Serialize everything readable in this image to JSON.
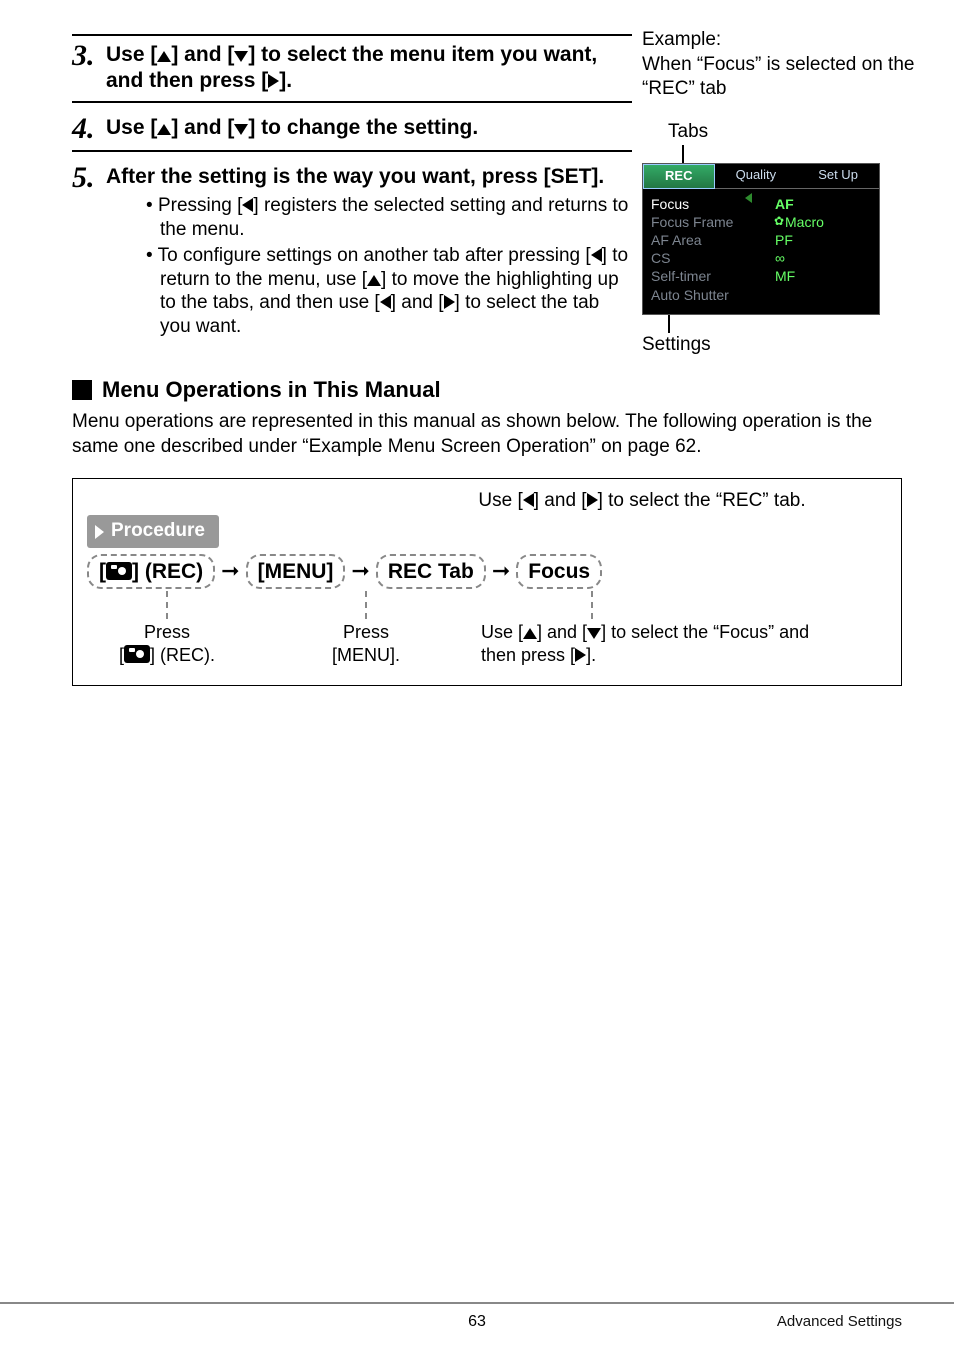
{
  "steps": {
    "s3": {
      "num": "3.",
      "body": "Use [▲] and [▼] to select the menu item you want, and then press [▶]."
    },
    "s4": {
      "num": "4.",
      "body": "Use [▲] and [▼] to change the setting."
    },
    "s5": {
      "num": "5.",
      "body": "After the setting is the way you want, press [SET]."
    },
    "s5_b1": "Pressing [◀] registers the selected setting and returns to the menu.",
    "s5_b2": "To configure settings on another tab after pressing [◀] to return to the menu, use [▲] to move the highlighting up to the tabs, and then use [◀] and [▶] to select the tab you want."
  },
  "aside": {
    "ex_label": "Example:",
    "ex_line": "When “Focus” is selected on the “REC” tab",
    "tabs_label": "Tabs",
    "settings_label": "Settings",
    "camera": {
      "tabs": {
        "rec": "REC",
        "quality": "Quality",
        "setup": "Set Up"
      },
      "left": [
        "Focus",
        "Focus Frame",
        "AF Area",
        "CS",
        "Self-timer",
        "Auto Shutter"
      ],
      "right": [
        "AF",
        "Macro",
        "PF",
        "∞",
        "MF"
      ]
    }
  },
  "subhead": "Menu Operations in This Manual",
  "subpara": "Menu operations are represented in this manual as shown below. The following operation is the same one described under “Example Menu Screen Operation” on page 62.",
  "proc": {
    "top_hint": "Use [◀] and [▶] to select the “REC” tab.",
    "badge": "Procedure",
    "flow": {
      "a_pre": "[",
      "a_mid": "] (REC)",
      "b": "[MENU]",
      "c": "REC Tab",
      "d": "Focus"
    },
    "col_a_1": "Press",
    "col_a_2_pre": "[",
    "col_a_2_post": "] (REC).",
    "col_b_1": "Press",
    "col_b_2": "[MENU].",
    "col_c_1": "Use [▲] and [▼] to select the “Focus” and",
    "col_c_2": "then press [▶]."
  },
  "footer": {
    "page": "63",
    "section": "Advanced Settings"
  }
}
